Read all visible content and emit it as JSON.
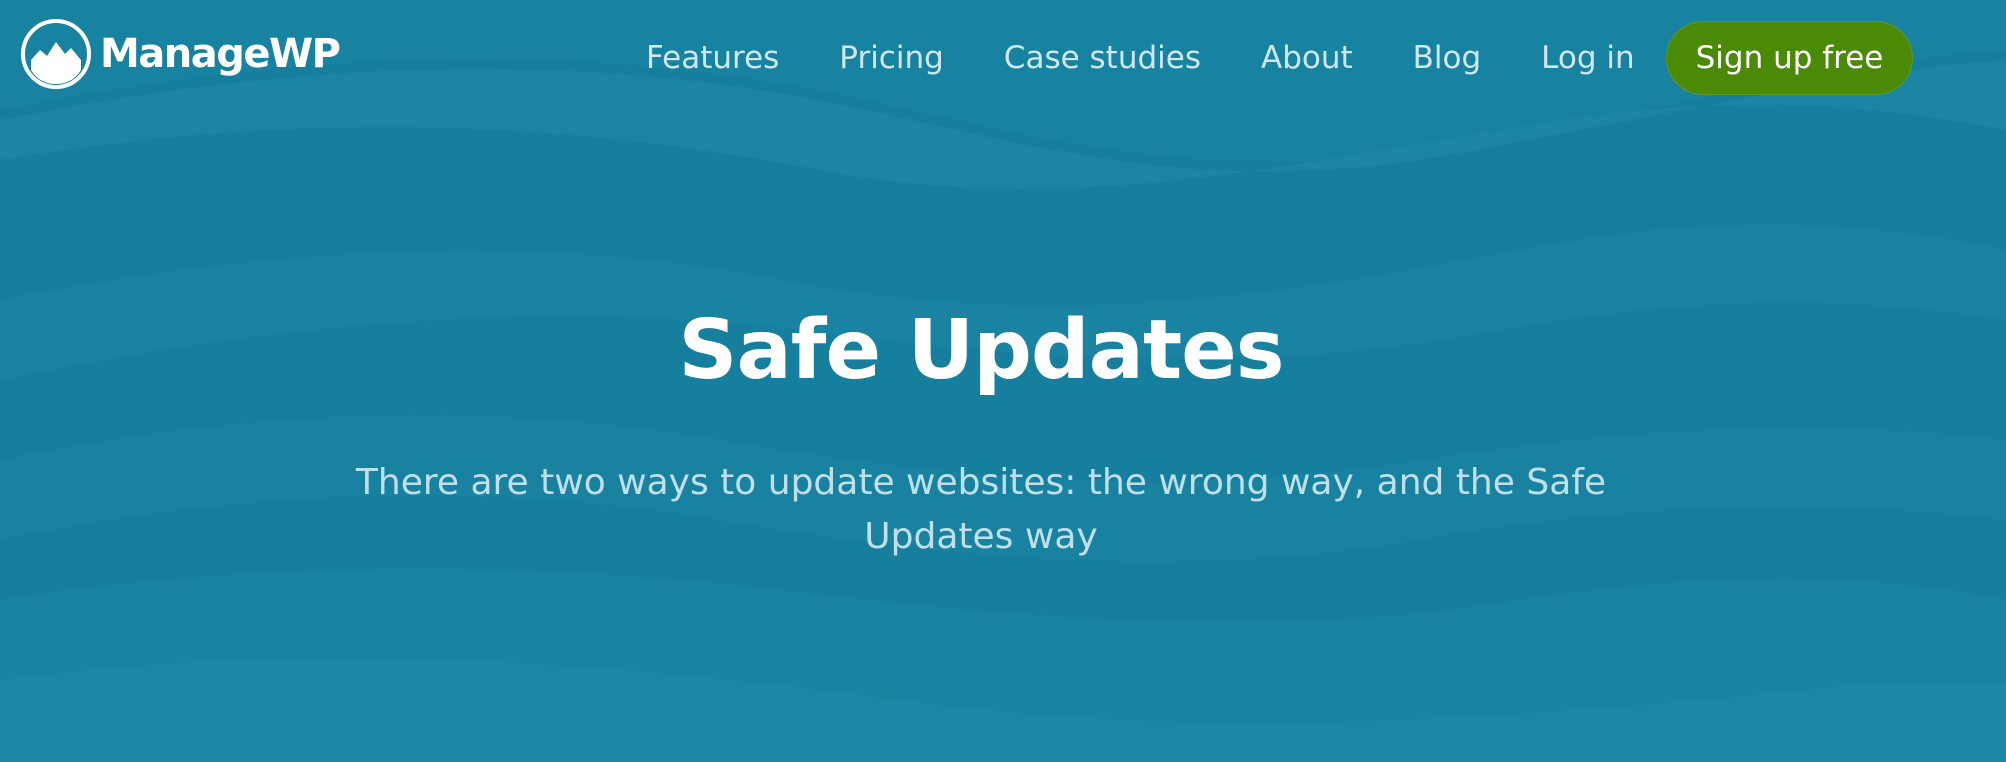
{
  "brand": {
    "name": "ManageWP",
    "logo_icon": "mountain-circle-icon"
  },
  "nav": {
    "items": [
      {
        "label": "Features"
      },
      {
        "label": "Pricing"
      },
      {
        "label": "Case studies"
      },
      {
        "label": "About"
      },
      {
        "label": "Blog"
      },
      {
        "label": "Log in"
      }
    ],
    "cta_label": "Sign up free"
  },
  "hero": {
    "title": "Safe Updates",
    "subtitle": "There are two ways to update websites: the wrong way, and the Safe Updates way"
  },
  "colors": {
    "background": "#177f9e",
    "cta_background": "#4b8a06",
    "nav_text": "#cfe7ef",
    "title_text": "#ffffff",
    "subtitle_text": "#bfe0ea"
  }
}
